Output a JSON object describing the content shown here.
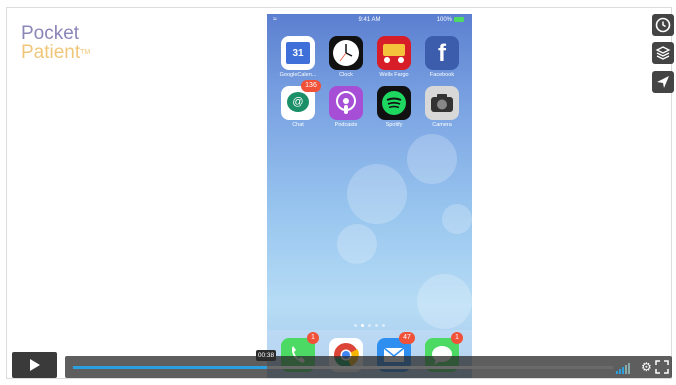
{
  "brand": {
    "line1": "Pocket",
    "line2": "Patient",
    "tm": "TM"
  },
  "phone": {
    "status_time": "9:41 AM",
    "status_battery": "100%",
    "apps": [
      {
        "label": "GoogleCalen...",
        "icon": "calendar-icon",
        "badge": "",
        "glyph": "31"
      },
      {
        "label": "Clock",
        "icon": "clock-icon",
        "badge": "",
        "glyph": ""
      },
      {
        "label": "Wells Fargo",
        "icon": "wells-fargo-icon",
        "badge": "",
        "glyph": ""
      },
      {
        "label": "Facebook",
        "icon": "facebook-icon",
        "badge": "",
        "glyph": "f"
      },
      {
        "label": "Chat",
        "icon": "chat-icon",
        "badge": "136",
        "glyph": "@"
      },
      {
        "label": "Podcasts",
        "icon": "podcasts-icon",
        "badge": "",
        "glyph": ""
      },
      {
        "label": "Spotify",
        "icon": "spotify-icon",
        "badge": "",
        "glyph": ""
      },
      {
        "label": "Camera",
        "icon": "camera-icon",
        "badge": "",
        "glyph": ""
      }
    ],
    "dock": [
      {
        "icon": "phone-icon",
        "badge": "1"
      },
      {
        "icon": "chrome-icon",
        "badge": ""
      },
      {
        "icon": "mail-icon",
        "badge": "47"
      },
      {
        "icon": "messages-icon",
        "badge": "1"
      }
    ]
  },
  "side_buttons": [
    "clock-icon",
    "layers-icon",
    "send-icon"
  ],
  "player": {
    "current_time": "00:38",
    "progress": 0.36,
    "colors": {
      "accent": "#2b9fe0"
    }
  }
}
